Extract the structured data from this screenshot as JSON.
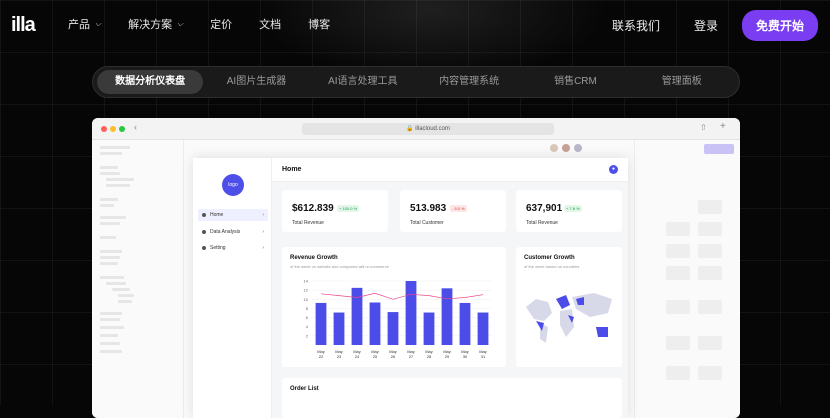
{
  "brand": {
    "logo_text": "illa"
  },
  "nav": {
    "items": [
      {
        "label": "产品",
        "has_dropdown": true
      },
      {
        "label": "解决方案",
        "has_dropdown": true
      },
      {
        "label": "定价",
        "has_dropdown": false
      },
      {
        "label": "文档",
        "has_dropdown": false
      },
      {
        "label": "博客",
        "has_dropdown": false
      }
    ],
    "contact": "联系我们",
    "login": "登录",
    "cta": "免费开始"
  },
  "tabs": [
    "数据分析仪表盘",
    "AI图片生成器",
    "AI语言处理工具",
    "内容管理系统",
    "销售CRM",
    "管理面板"
  ],
  "active_tab": 0,
  "browser": {
    "url": "illacloud.com"
  },
  "app": {
    "avatar_text": "logo",
    "menu": [
      {
        "label": "Home",
        "active": true
      },
      {
        "label": "Data Analysis",
        "active": false
      },
      {
        "label": "Setting",
        "active": false
      }
    ],
    "header_title": "Home",
    "stats": [
      {
        "value": "$612.839",
        "delta": "+ 100.0 %",
        "trend": "up",
        "label": "Total Revenue"
      },
      {
        "value": "513.983",
        "delta": "- 5.0 %",
        "trend": "down",
        "label": "Total Customer"
      },
      {
        "value": "637,901",
        "delta": "+ 7.8 %",
        "trend": "up",
        "label": "Total Revenue"
      }
    ],
    "revenue": {
      "title": "Revenue Growth",
      "subtitle": "of the week on website and compared with e-commerce"
    },
    "customer": {
      "title": "Customer Growth",
      "subtitle": "of the week based on countries"
    },
    "order_title": "Order List"
  },
  "chart_data": {
    "type": "bar",
    "title": "Revenue Growth",
    "categories": [
      "May 22",
      "May 23",
      "May 24",
      "May 25",
      "May 26",
      "May 27",
      "May 28",
      "May 29",
      "May 30",
      "May 31"
    ],
    "tick_labels": [
      [
        "May",
        "22"
      ],
      [
        "May",
        "23"
      ],
      [
        "May",
        "24"
      ],
      [
        "May",
        "25"
      ],
      [
        "May",
        "26"
      ],
      [
        "May",
        "27"
      ],
      [
        "May",
        "28"
      ],
      [
        "May",
        "29"
      ],
      [
        "May",
        "30"
      ],
      [
        "May",
        "31"
      ]
    ],
    "series": [
      {
        "type": "bar",
        "values": [
          9.2,
          7.1,
          12.5,
          9.3,
          7.2,
          14.0,
          7.1,
          12.4,
          9.2,
          7.1
        ],
        "color": "#4c4ce8"
      },
      {
        "type": "line",
        "values": [
          11.2,
          10.8,
          10.4,
          11.3,
          10.0,
          11.1,
          10.8,
          10.1,
          10.4,
          11.0
        ],
        "color": "#e8458b"
      }
    ],
    "y_ticks": [
      14,
      12,
      10,
      8,
      6,
      4,
      2
    ],
    "ylim": [
      0,
      14
    ],
    "grid": true
  },
  "colors": {
    "accent": "#7a3df2",
    "bar": "#4c4ce8",
    "line": "#e8458b"
  }
}
